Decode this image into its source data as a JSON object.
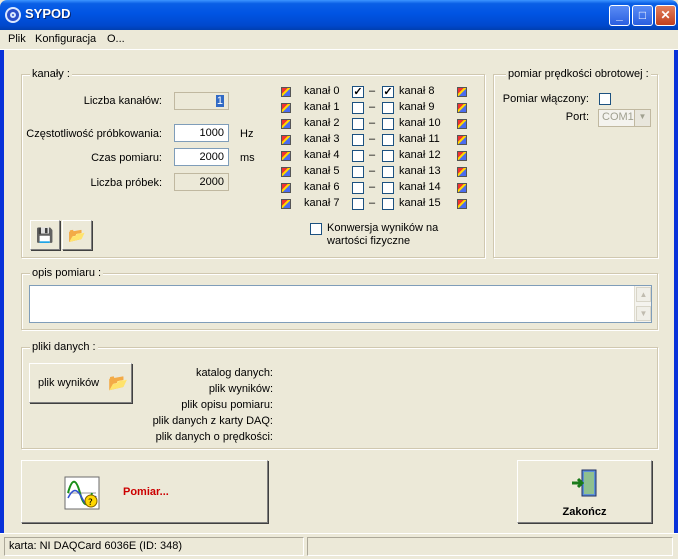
{
  "window": {
    "title": "SYPOD"
  },
  "menu": [
    "Plik",
    "Konfiguracja",
    "O..."
  ],
  "kanaly": {
    "title": "kanały :",
    "liczba_label": "Liczba kanałów:",
    "liczba_value": "1",
    "freq_label": "Częstotliwość próbkowania:",
    "freq_value": "1000",
    "freq_unit": "Hz",
    "czas_label": "Czas pomiaru:",
    "czas_value": "2000",
    "czas_unit": "ms",
    "probek_label": "Liczba próbek:",
    "probek_value": "2000",
    "channels_left": [
      {
        "label": "kanał 0",
        "checked": true
      },
      {
        "label": "kanał 1",
        "checked": false
      },
      {
        "label": "kanał 2",
        "checked": false
      },
      {
        "label": "kanał 3",
        "checked": false
      },
      {
        "label": "kanał 4",
        "checked": false
      },
      {
        "label": "kanał 5",
        "checked": false
      },
      {
        "label": "kanał 6",
        "checked": false
      },
      {
        "label": "kanał 7",
        "checked": false
      }
    ],
    "channels_right": [
      {
        "label": "kanał 8",
        "checked": true
      },
      {
        "label": "kanał 9",
        "checked": false
      },
      {
        "label": "kanał 10",
        "checked": false
      },
      {
        "label": "kanał 11",
        "checked": false
      },
      {
        "label": "kanał 12",
        "checked": false
      },
      {
        "label": "kanał 13",
        "checked": false
      },
      {
        "label": "kanał 14",
        "checked": false
      },
      {
        "label": "kanał 15",
        "checked": false
      }
    ],
    "dash": "–",
    "konwersja_line1": "Konwersja wyników na",
    "konwersja_line2": "wartości fizyczne"
  },
  "predkosc": {
    "title": "pomiar prędkości obrotowej :",
    "wlaczony_label": "Pomiar włączony:",
    "port_label": "Port:",
    "port_value": "COM1"
  },
  "opis": {
    "title": "opis pomiaru :",
    "value": ""
  },
  "pliki": {
    "title": "pliki danych :",
    "button_label": "plik wyników",
    "labels": [
      "katalog danych:",
      "plik wyników:",
      "plik opisu pomiaru:",
      "plik danych z karty DAQ:",
      "plik danych o prędkości:"
    ]
  },
  "actions": {
    "pomiar_label": "Pomiar...",
    "zakoncz_label": "Zakończ"
  },
  "status": {
    "karta": "karta: NI DAQCard 6036E (ID: 348)",
    "pane2": ""
  },
  "colors": {
    "pomiar_text": "#cc0000",
    "title_bar": "#0054e3"
  }
}
